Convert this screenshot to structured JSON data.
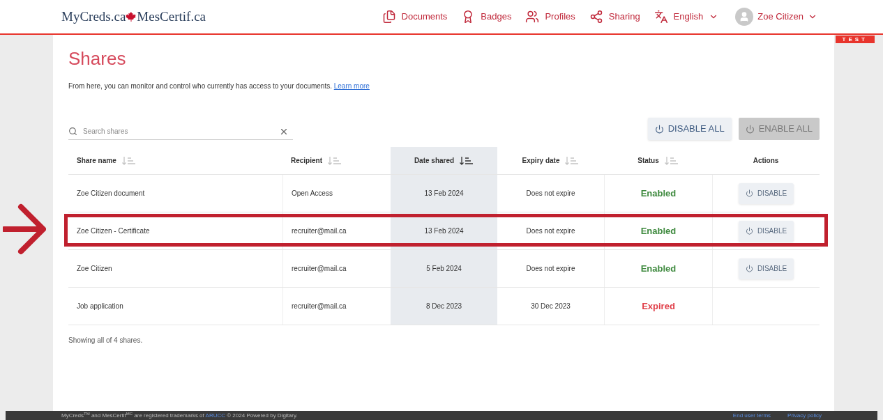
{
  "header": {
    "logo_left": "MyCreds.ca",
    "logo_right": "MesCertif.ca",
    "nav": [
      {
        "kind": "documents",
        "label": "Documents"
      },
      {
        "kind": "badges",
        "label": "Badges"
      },
      {
        "kind": "profiles",
        "label": "Profiles"
      },
      {
        "kind": "sharing",
        "label": "Sharing"
      },
      {
        "kind": "language",
        "label": "English"
      }
    ],
    "user": "Zoe Citizen"
  },
  "env_badge": "TEST",
  "page": {
    "title": "Shares",
    "intro": "From here, you can monitor and control who currently has access to your documents.",
    "learn_more": "Learn more"
  },
  "search": {
    "placeholder": "Search shares"
  },
  "bulk_actions": [
    {
      "label": "DISABLE ALL",
      "disabled": false
    },
    {
      "label": "ENABLE ALL",
      "disabled": true
    }
  ],
  "table": {
    "columns": [
      {
        "label": "Share name",
        "sortable": true,
        "selected": false
      },
      {
        "label": "Recipient",
        "sortable": true,
        "selected": false
      },
      {
        "label": "Date shared",
        "sortable": true,
        "selected": true
      },
      {
        "label": "Expiry date",
        "sortable": true,
        "selected": false
      },
      {
        "label": "Status",
        "sortable": true,
        "selected": false
      },
      {
        "label": "Actions",
        "sortable": false,
        "selected": false
      }
    ],
    "rows": [
      {
        "name": "Zoe Citizen document",
        "recipient": "Open Access",
        "date_shared": "13 Feb 2024",
        "expiry": "Does not expire",
        "status": {
          "kind": "enabled",
          "label": "Enabled"
        },
        "action": "DISABLE",
        "highlighted": false
      },
      {
        "name": "Zoe Citizen - Certificate",
        "recipient": "recruiter@mail.ca",
        "date_shared": "13 Feb 2024",
        "expiry": "Does not expire",
        "status": {
          "kind": "enabled",
          "label": "Enabled"
        },
        "action": "DISABLE",
        "highlighted": true
      },
      {
        "name": "Zoe Citizen",
        "recipient": "recruiter@mail.ca",
        "date_shared": "5 Feb 2024",
        "expiry": "Does not expire",
        "status": {
          "kind": "enabled",
          "label": "Enabled"
        },
        "action": "DISABLE",
        "highlighted": false
      },
      {
        "name": "Job application",
        "recipient": "recruiter@mail.ca",
        "date_shared": "8 Dec 2023",
        "expiry": "30 Dec 2023",
        "status": {
          "kind": "expired",
          "label": "Expired"
        },
        "highlighted": false
      }
    ]
  },
  "summary": "Showing all of 4 shares.",
  "footer": {
    "notice_before": "MyCreds$^{TM}$ and MesCertif$^{MC}$ are registered trademarks of",
    "notice_link": "ARUCC",
    "notice_after": "© 2024 Powered by Digitary.",
    "links": [
      "End user terms",
      "Privacy policy"
    ]
  }
}
